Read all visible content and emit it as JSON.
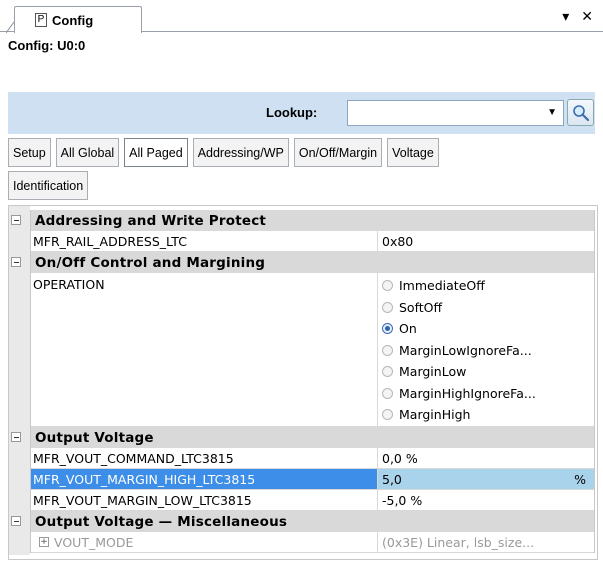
{
  "window": {
    "tab_label": "Config",
    "pin_glyph": "P",
    "dropdown_glyph": "▾",
    "close_glyph": "✕"
  },
  "config_title": "Config: U0:0",
  "lookup": {
    "label": "Lookup:",
    "value": "",
    "placeholder": ""
  },
  "tabs": [
    {
      "label": "Setup",
      "active": false
    },
    {
      "label": "All Global",
      "active": false
    },
    {
      "label": "All Paged",
      "active": true
    },
    {
      "label": "Addressing/WP",
      "active": false
    },
    {
      "label": "On/Off/Margin",
      "active": false
    },
    {
      "label": "Voltage",
      "active": false
    },
    {
      "label": "Identification",
      "active": false
    }
  ],
  "grid": {
    "addressing": {
      "title": "Addressing and Write Protect",
      "rows": [
        {
          "name": "MFR_RAIL_ADDRESS_LTC",
          "value": "0x80"
        }
      ]
    },
    "onoff": {
      "title": "On/Off Control and Margining",
      "operation_name": "OPERATION",
      "options": [
        {
          "label": "ImmediateOff",
          "checked": false
        },
        {
          "label": "SoftOff",
          "checked": false
        },
        {
          "label": "On",
          "checked": true
        },
        {
          "label": "MarginLowIgnoreFa...",
          "checked": false
        },
        {
          "label": "MarginLow",
          "checked": false
        },
        {
          "label": "MarginHighIgnoreFa...",
          "checked": false
        },
        {
          "label": "MarginHigh",
          "checked": false
        }
      ]
    },
    "output_voltage": {
      "title": "Output Voltage",
      "rows": [
        {
          "name": "MFR_VOUT_COMMAND_LTC3815",
          "value": "0,0 %"
        },
        {
          "name": "MFR_VOUT_MARGIN_HIGH_LTC3815",
          "value": "5,0",
          "unit": "%"
        },
        {
          "name": "MFR_VOUT_MARGIN_LOW_LTC3815",
          "value": "-5,0 %"
        }
      ]
    },
    "output_misc": {
      "title": "Output Voltage — Miscellaneous",
      "rows": [
        {
          "name": "VOUT_MODE",
          "value": "(0x3E) Linear, lsb_size..."
        }
      ]
    }
  },
  "colors": {
    "lookup_bar": "#cfe0f3",
    "selected_name": "#3d8ee8",
    "selected_value": "#a9d3ea",
    "category_bg": "#d9d9d9"
  }
}
